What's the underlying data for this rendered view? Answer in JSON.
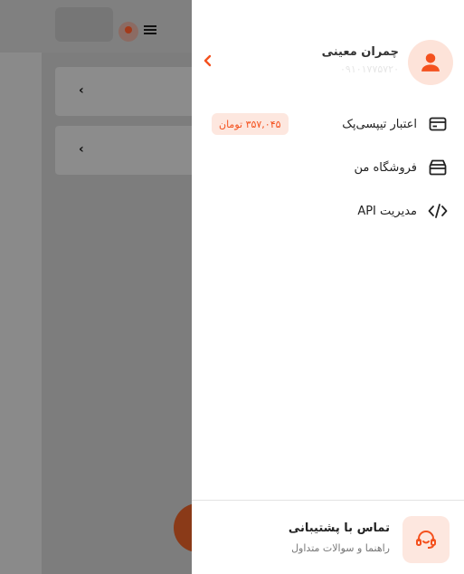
{
  "profile": {
    "name": "چمران معینی",
    "phone": "۰۹۱۰۱۷۷۵۷۲۰"
  },
  "menu": {
    "credit_label": "اعتبار تیپسی‌پک",
    "credit_amount": "۳۵۷,۰۴۵ تومان",
    "shop_label": "فروشگاه من",
    "api_label": "مدیریت API"
  },
  "support": {
    "title": "تماس با پشتیبانی",
    "subtitle": "راهنما و سوالات متداول"
  },
  "icons": {
    "profile": "user-icon",
    "expand": "chevron-left-icon",
    "credit": "credit-card-icon",
    "shop": "store-icon",
    "api": "code-icon",
    "support": "headset-icon",
    "menu": "hamburger-icon"
  },
  "colors": {
    "accent": "#f4511e",
    "accent_light": "#fde7df",
    "overlay": "#8a8a8a",
    "drawer_bg": "#ffffff"
  }
}
